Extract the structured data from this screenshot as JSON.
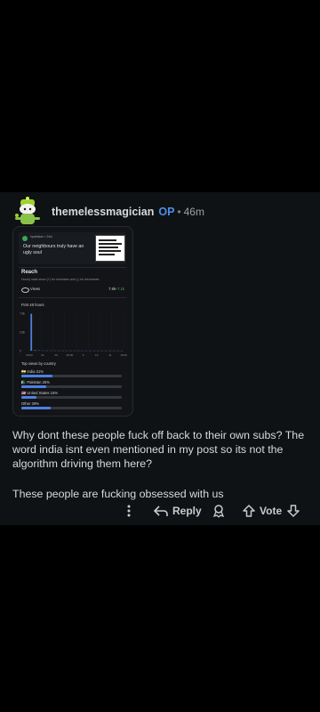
{
  "comment": {
    "username": "themelessmagician",
    "op_badge": "OP",
    "separator": "•",
    "time": "46m",
    "body": [
      "Why dont these people fuck off back to their own subs? The word india isnt even mentioned in my post so its not the algorithm driving them here?",
      "These people are fucking obsessed with us"
    ]
  },
  "screenshot": {
    "post_user": "r/pakistan • 24m",
    "post_title": "Our neighbours truly have an ugly soul",
    "reach_title": "Reach",
    "reach_subtitle": "Hourly stats show (+) for increases and (-) for decreases",
    "views_label": "Views",
    "views_value": "7.6k",
    "views_delta": "+7.1k",
    "first_hours_label": "First 48 hours",
    "top_views_label": "Top views by country",
    "chart_data": {
      "type": "bar",
      "title": "First 48 hours",
      "y_ticks": [
        "7.5k",
        "3.8k",
        "0"
      ],
      "x_ticks": [
        "20:00",
        "01",
        "02",
        "06:00",
        "6",
        "10",
        "11",
        "16:00"
      ],
      "values": [
        7400,
        120,
        60,
        40,
        30,
        25,
        20,
        18,
        15,
        12,
        10,
        10,
        8,
        8,
        6,
        6,
        5,
        5,
        4,
        4,
        3,
        3,
        3,
        2
      ],
      "ylim": [
        0,
        7500
      ],
      "bar_color": "#4f7fe0"
    },
    "countries": [
      {
        "flag": "🇮🇳",
        "name": "India",
        "pct": "31%",
        "value": 0.31
      },
      {
        "flag": "🇵🇰",
        "name": "Pakistan",
        "pct": "25%",
        "value": 0.25
      },
      {
        "flag": "🇺🇸",
        "name": "United States",
        "pct": "15%",
        "value": 0.15
      },
      {
        "flag": "",
        "name": "Other",
        "pct": "29%",
        "value": 0.29
      }
    ]
  },
  "actions": {
    "more_icon": "more-vertical-icon",
    "reply_label": "Reply",
    "vote_label": "Vote",
    "award_icon": "award-icon"
  },
  "colors": {
    "background": "#000000",
    "card": "#0f1214",
    "op": "#4f8fe8",
    "accent": "#4f7fe0"
  }
}
